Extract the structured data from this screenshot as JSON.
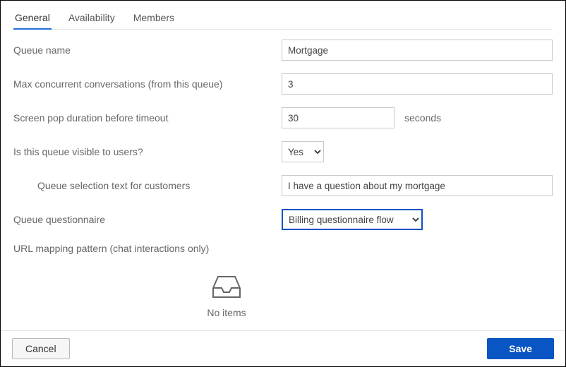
{
  "tabs": {
    "general": "General",
    "availability": "Availability",
    "members": "Members"
  },
  "fields": {
    "queue_name": {
      "label": "Queue name",
      "value": "Mortgage"
    },
    "max_concurrent": {
      "label": "Max concurrent conversations (from this queue)",
      "value": "3"
    },
    "screen_pop": {
      "label": "Screen pop duration before timeout",
      "value": "30",
      "suffix": "seconds"
    },
    "visible": {
      "label": "Is this queue visible to users?",
      "value": "Yes"
    },
    "selection_text": {
      "label": "Queue selection text for customers",
      "value": "I have a question about my mortgage"
    },
    "questionnaire": {
      "label": "Queue questionnaire",
      "value": "Billing questionnaire flow"
    },
    "url_mapping": {
      "label": "URL mapping pattern (chat interactions only)"
    }
  },
  "empty_state": "No items",
  "buttons": {
    "cancel": "Cancel",
    "save": "Save"
  }
}
